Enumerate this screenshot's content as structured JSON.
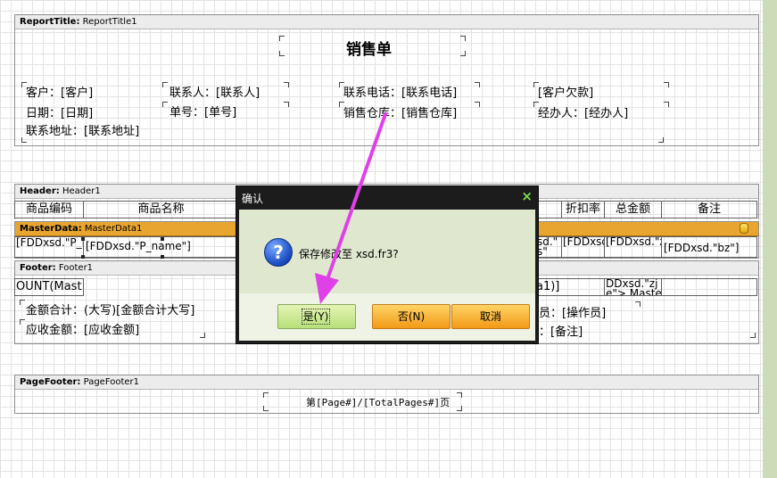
{
  "colors": {
    "arrow": "#e040e8",
    "master_band": "#e8a530",
    "side_panel": "#cddcb8"
  },
  "bands": {
    "report_title": {
      "kind": "ReportTitle:",
      "name": "ReportTitle1"
    },
    "header": {
      "kind": "Header:",
      "name": "Header1"
    },
    "master": {
      "kind": "MasterData:",
      "name": "MasterData1"
    },
    "footer": {
      "kind": "Footer:",
      "name": "Footer1"
    },
    "page_footer": {
      "kind": "PageFooter:",
      "name": "PageFooter1"
    }
  },
  "title": {
    "heading": "销售单",
    "customer": "客户：[客户]",
    "contact": "联系人：[联系人]",
    "phone": "联系电话：[联系电话]",
    "debt": "[客户欠款]",
    "date": "日期：[日期]",
    "order_no": "单号：[单号]",
    "warehouse": "销售仓库：[销售仓库]",
    "handler": "经办人：[经办人]",
    "address": "联系地址：[联系地址]"
  },
  "header_cols": {
    "code": "商品编码",
    "name": "商品名称",
    "discount": "折扣率",
    "total": "总金额",
    "note": "备注"
  },
  "master_cells": {
    "pid": "[FDDxsd.\"P_ID\"]",
    "pname": "[FDDxsd.\"P_name\"]",
    "partial": "sd.\"\ns\"",
    "dzl": "[FDDxsd.\"dzl\"]",
    "zje": "[FDDxsd.\"zje\"]",
    "bz": "[FDDxsd.\"bz\"]"
  },
  "footer": {
    "count": "OUNT(Mast",
    "partial_a1": "a1)]",
    "zje_sum": "DDxsd.\"zj\ne\">,Maste",
    "amount_total": "金额合计：(大写)[金额合计大写]",
    "receivable": "应收金额：[应收金额]",
    "operator": "员：[操作员]",
    "note": "：[备注]"
  },
  "page_footer": {
    "page": "第[Page#]/[TotalPages#]页"
  },
  "dialog": {
    "title": "确认",
    "close_glyph": "×",
    "icon_glyph": "?",
    "message": "保存修改至 xsd.fr3?",
    "yes_label": "是(Y)",
    "no_label": "否(N)",
    "cancel_label": "取消"
  }
}
